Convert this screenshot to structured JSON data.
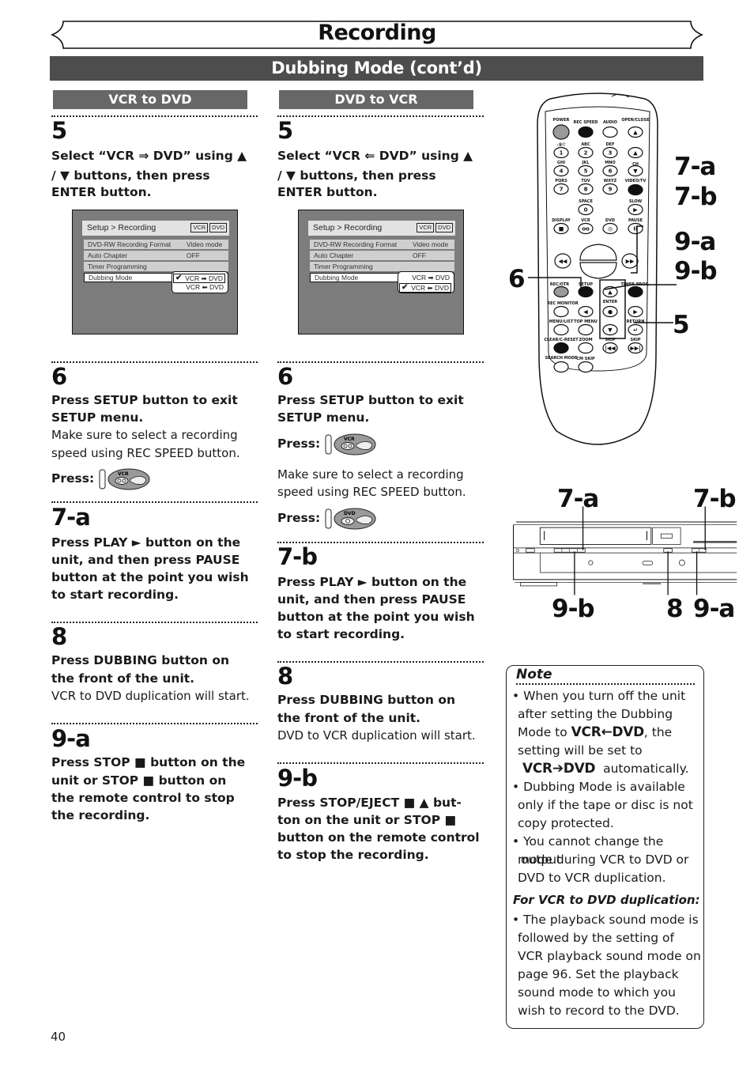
{
  "page": {
    "title": "Recording",
    "section": "Dubbing Mode (cont’d)",
    "page_number": "40"
  },
  "columns": [
    {
      "header": "VCR to DVD",
      "steps": {
        "s5": {
          "num": "5",
          "line1": "Select “VCR ⇒ DVD” using ▲",
          "line2": "/ ▼ buttons, then press",
          "line3": "ENTER button."
        },
        "osd": {
          "breadcrumb": "Setup > Recording",
          "tags": [
            "VCR",
            "DVD"
          ],
          "rows": [
            {
              "label": "DVD-RW Recording Format",
              "value": "Video mode"
            },
            {
              "label": "Auto Chapter",
              "value": "OFF"
            },
            {
              "label": "Timer Programming",
              "value": ""
            },
            {
              "label": "Dubbing Mode",
              "value": ""
            }
          ],
          "options": [
            "VCR ➡ DVD",
            "VCR ⬅ DVD"
          ],
          "checked_option": 0,
          "check_glyph": "✔"
        },
        "s6": {
          "num": "6",
          "bold1": "Press SETUP button to exit",
          "bold2": "SETUP menu.",
          "plain1": "Make sure to select a recording",
          "plain2": "speed using REC SPEED button.",
          "press": "Press:",
          "press_icon_label": "VCR"
        },
        "s7": {
          "num": "7-a",
          "l1": "Press PLAY ► button on the",
          "l2": "unit, and then press PAUSE",
          "l3": "button at the point you wish",
          "l4": "to start recording."
        },
        "s8": {
          "num": "8",
          "bold1": "Press DUBBING button on",
          "bold2": "the front of the unit.",
          "plain1": "VCR to DVD duplication will start."
        },
        "s9": {
          "num": "9-a",
          "l1": "Press STOP ■ button on the",
          "l2": "unit or STOP ■ button on",
          "l3": "the remote control to stop",
          "l4": "the recording."
        }
      }
    },
    {
      "header": "DVD to VCR",
      "steps": {
        "s5": {
          "num": "5",
          "line1": "Select “VCR ⇐ DVD” using ▲",
          "line2": "/ ▼ buttons, then press",
          "line3": "ENTER button."
        },
        "osd": {
          "breadcrumb": "Setup > Recording",
          "tags": [
            "VCR",
            "DVD"
          ],
          "rows": [
            {
              "label": "DVD-RW Recording Format",
              "value": "Video mode"
            },
            {
              "label": "Auto Chapter",
              "value": "OFF"
            },
            {
              "label": "Timer Programming",
              "value": ""
            },
            {
              "label": "Dubbing Mode",
              "value": ""
            }
          ],
          "options": [
            "VCR ➡ DVD",
            "VCR ⬅ DVD"
          ],
          "checked_option": 1,
          "check_glyph": "✔"
        },
        "s6": {
          "num": "6",
          "bold1": "Press SETUP button to exit",
          "bold2": "SETUP menu.",
          "press": "Press:",
          "press_icon_label": "VCR",
          "plain1": "Make sure to select a recording",
          "plain2": "speed using REC SPEED button.",
          "press2": "Press:",
          "press2_icon_label": "DVD"
        },
        "s7": {
          "num": "7-b",
          "l1": "Press PLAY ► button on the",
          "l2": "unit, and then press PAUSE",
          "l3": "button at the point you wish",
          "l4": "to start recording."
        },
        "s8": {
          "num": "8",
          "bold1": "Press DUBBING button on",
          "bold2": "the front of the unit.",
          "plain1": "DVD to VCR duplication will start."
        },
        "s9": {
          "num": "9-b",
          "l1": "Press STOP/EJECT ■ ▲ but-",
          "l2": "ton on the unit or STOP ■",
          "l3": "button on the remote control",
          "l4": "to stop the recording."
        }
      }
    }
  ],
  "remote": {
    "labels": {
      "power": "POWER",
      "rec_speed": "REC SPEED",
      "audio": "AUDIO",
      "open_close": "OPEN/CLOSE",
      "k1_sub": ".@/:",
      "k2_sub": "ABC",
      "k3_sub": "DEF",
      "k4_sub": "GHI",
      "k5_sub": "JKL",
      "k6_sub": "MNO",
      "k7_sub": "PQRS",
      "k8_sub": "TUV",
      "k9_sub": "WXYZ",
      "video_tv": "VIDEO/TV",
      "space": "SPACE",
      "slow": "SLOW",
      "ch": "CH",
      "display": "DISPLAY",
      "vcr": "VCR",
      "dvd": "DVD",
      "pause": "PAUSE",
      "play": "PLAY",
      "stop": "STOP",
      "rec_otr": "REC/OTR",
      "setup": "SETUP",
      "timer_prog": "TIMER PROG.",
      "rec_monitor": "REC MONITOR",
      "enter": "ENTER",
      "menu_list": "MENU/LIST",
      "top_menu": "TOP MENU",
      "return": "RETURN",
      "clear_reset": "CLEAR/C-RESET",
      "zoom": "ZOOM",
      "skip_back": "SKIP",
      "skip_fwd": "SKIP",
      "search_mode": "SEARCH MODE",
      "cm_skip": "CM SKIP"
    },
    "digits": [
      "1",
      "2",
      "3",
      "4",
      "5",
      "6",
      "7",
      "8",
      "9",
      "0"
    ],
    "callouts": {
      "c7a": "7-a",
      "c7b": "7-b",
      "c9a": "9-a",
      "c9b": "9-b",
      "c6": "6",
      "c5": "5"
    }
  },
  "unit": {
    "callouts": {
      "top_left": "7-a",
      "top_right": "7-b",
      "bottom_left": "9-b",
      "bottom_mid": "8",
      "bottom_right": "9-a"
    }
  },
  "note": {
    "title": "Note",
    "b1_l1": "• When you turn off the unit",
    "b1_l2": "after setting the Dubbing",
    "b1_l3a": "Mode to ",
    "b1_mode1": "VCR←DVD",
    "b1_l3b": ", the",
    "b1_l4": "setting will be set to",
    "b1_mode2": "VCR➔DVD",
    "b1_l5b": "automatically.",
    "b2_l1": "• Dubbing Mode is available",
    "b2_l2": "only if the tape or disc is not",
    "b2_l3": "copy protected.",
    "b3_l1": "• You cannot change the output",
    "b3_l2": "mode during VCR to DVD or",
    "b3_l3": "DVD to VCR duplication.",
    "sub": "For VCR to DVD duplication:",
    "b4_l1": "• The playback sound mode is",
    "b4_l2": "followed by the setting of",
    "b4_l3": "VCR playback sound mode on",
    "b4_l4": "page 96. Set the playback",
    "b4_l5": "sound mode to which you",
    "b4_l6": "wish to record to the DVD."
  }
}
